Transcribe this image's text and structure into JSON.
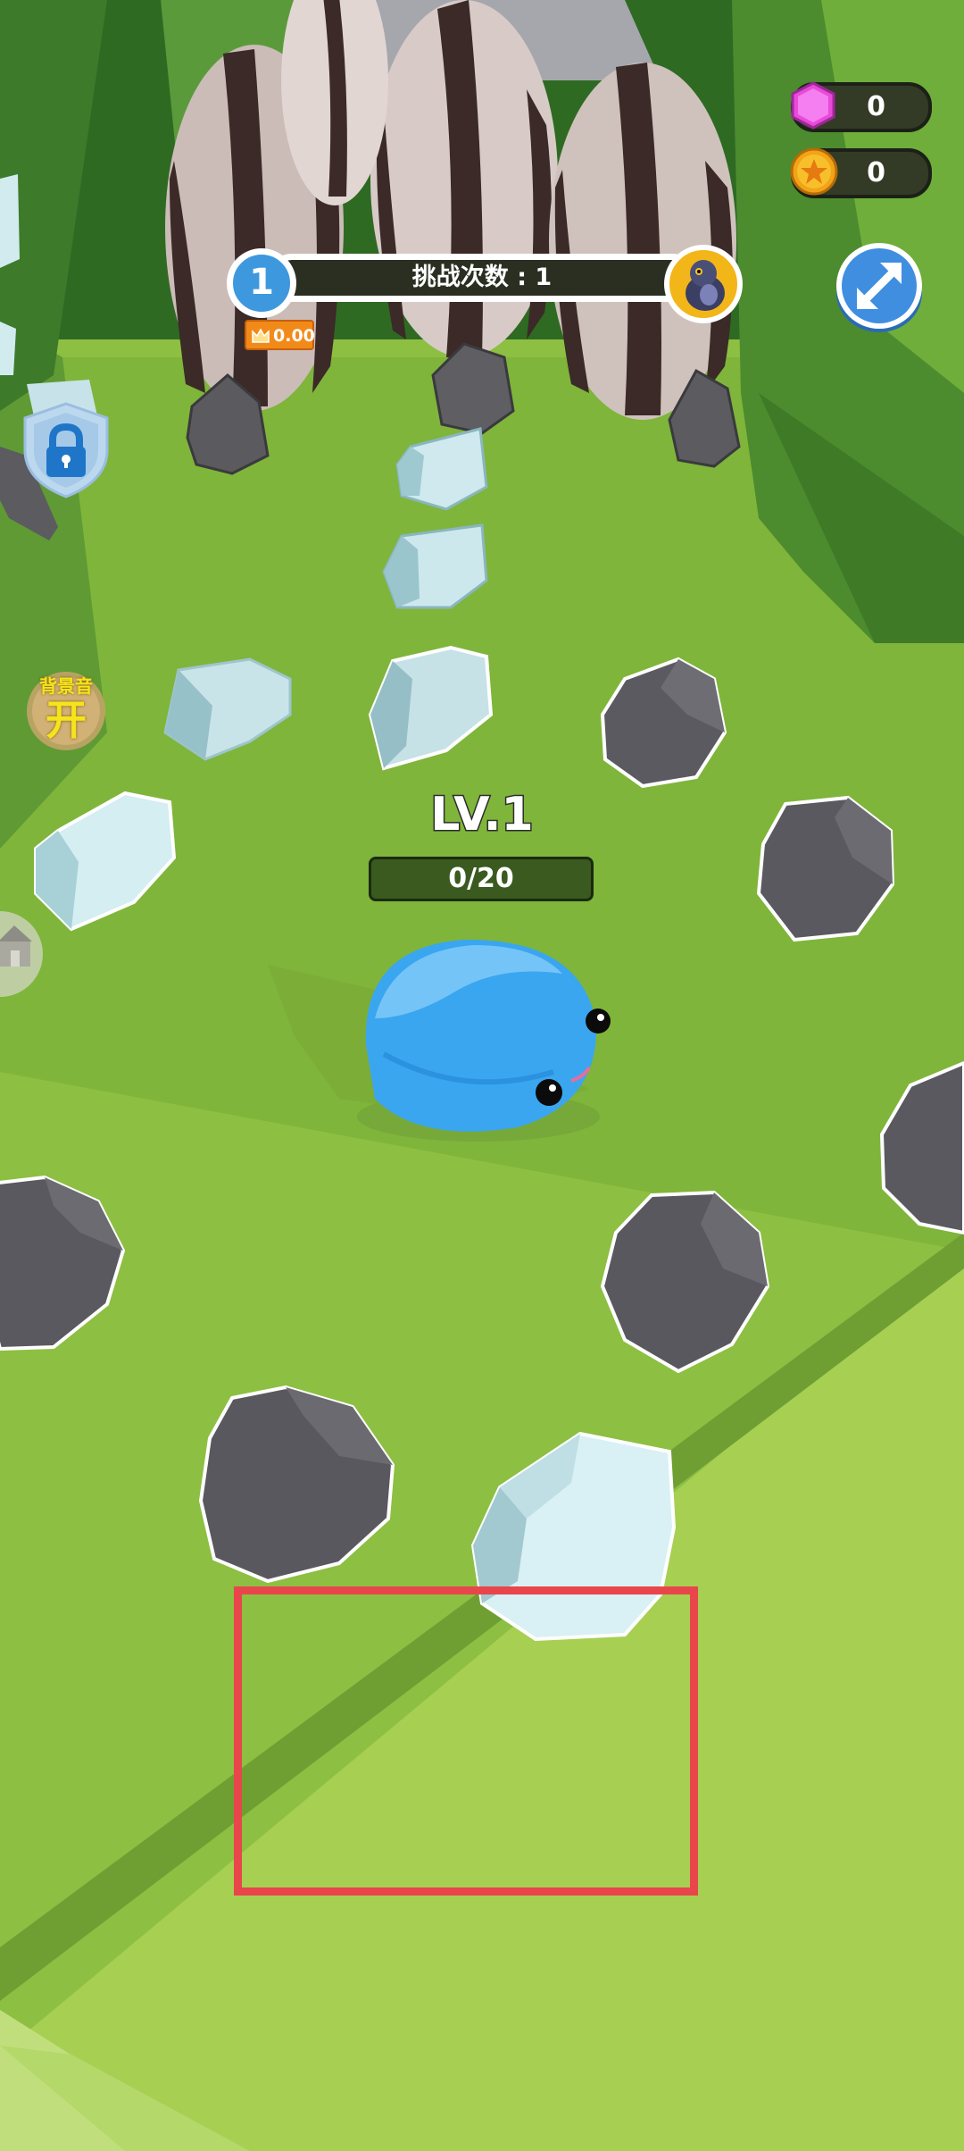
{
  "hud": {
    "gems": {
      "icon": "gem-icon",
      "value": "0",
      "color": "#e84bd8"
    },
    "coins": {
      "icon": "star-coin-icon",
      "value": "0",
      "color": "#f2a318"
    }
  },
  "challenge": {
    "level_number": "1",
    "attempts_label": "挑战次数 : 1",
    "score": "0.00",
    "boss_icon": "pigeon-boss-icon"
  },
  "buttons": {
    "expand_icon": "expand-arrows-icon",
    "lock_icon": "lock-shield-icon",
    "shop_icon": "shop-icon"
  },
  "bgm": {
    "label": "背景音",
    "state": "开"
  },
  "player": {
    "level": "LV.1",
    "xp": "0/20",
    "color": "#3aa6f0"
  },
  "colors": {
    "grass": "#8fc044",
    "grass_light": "#a6cf52",
    "rock": "#55555a",
    "ice": "#bfe0e6",
    "highlight": "#e8464b"
  }
}
